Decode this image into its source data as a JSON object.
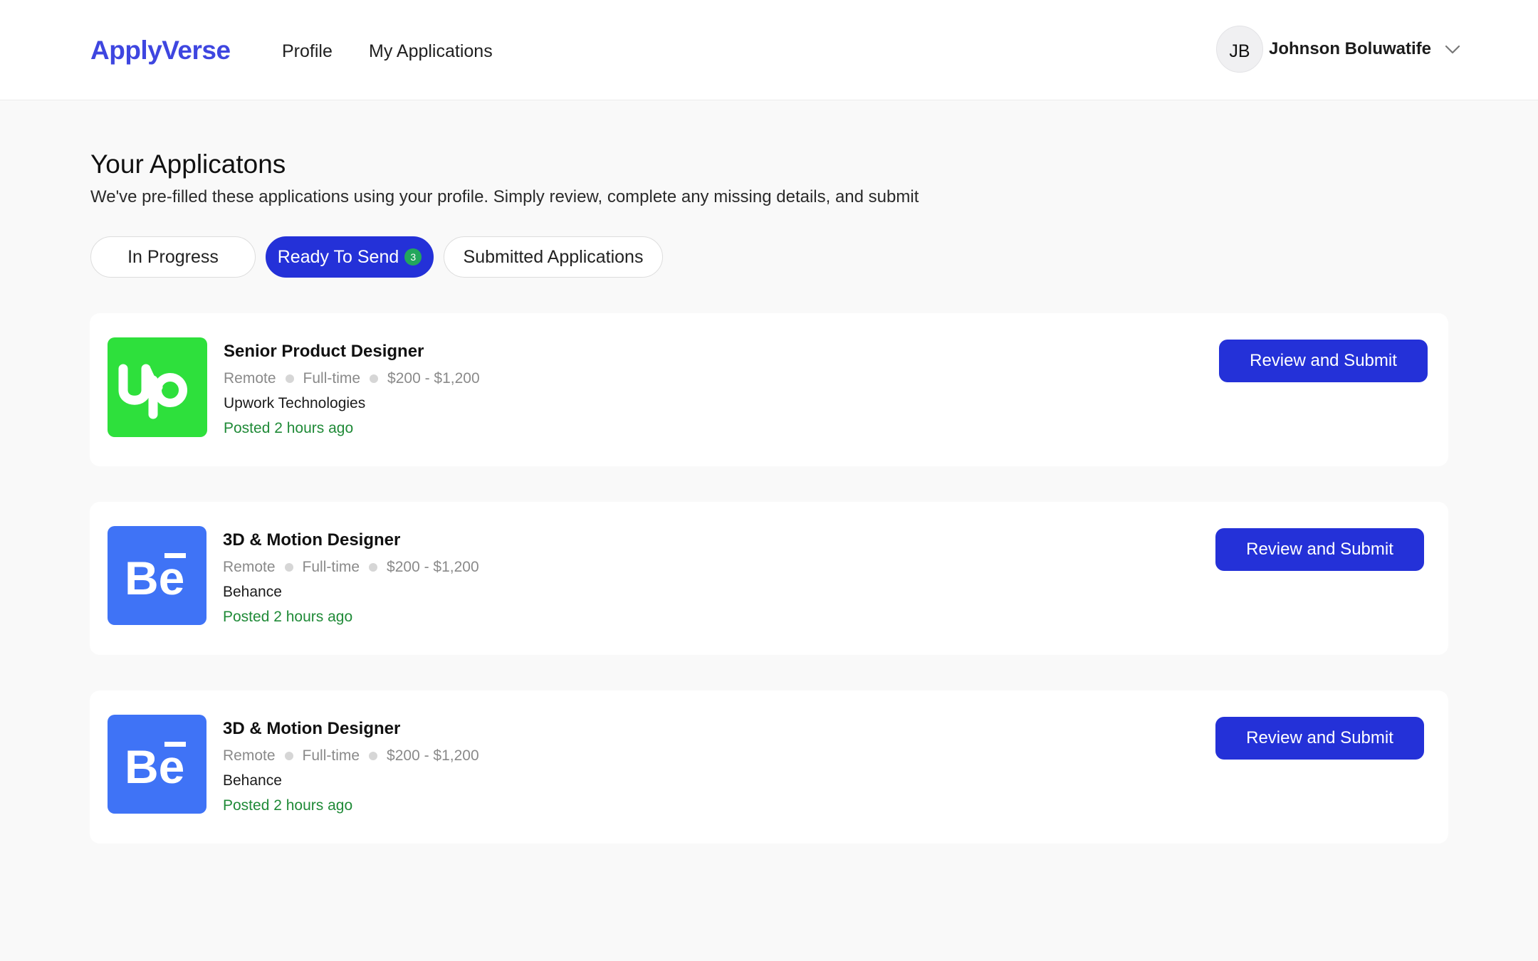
{
  "header": {
    "brand": "ApplyVerse",
    "nav": {
      "profile": "Profile",
      "my_applications": "My Applications"
    },
    "user": {
      "initials": "JB",
      "name": "Johnson Boluwatife"
    }
  },
  "page": {
    "title": "Your Applicatons",
    "subtitle": "We've pre-filled these applications using your profile. Simply review, complete any missing details, and submit"
  },
  "tabs": [
    {
      "label": "In Progress",
      "active": false
    },
    {
      "label": "Ready To Send",
      "active": true,
      "badge": "3"
    },
    {
      "label": "Submitted Applications",
      "active": false
    }
  ],
  "jobs": [
    {
      "title": "Senior Product Designer",
      "location": "Remote",
      "type": "Full-time",
      "salary": "$200 - $1,200",
      "company": "Upwork Technologies",
      "posted": "Posted 2 hours ago",
      "logo_icon": "upwork-logo-icon",
      "cta": "Review and Submit"
    },
    {
      "title": "3D & Motion Designer",
      "location": "Remote",
      "type": "Full-time",
      "salary": "$200 - $1,200",
      "company": "Behance",
      "posted": "Posted 2 hours ago",
      "logo_icon": "behance-logo-icon",
      "cta": "Review and Submit"
    },
    {
      "title": "3D & Motion Designer",
      "location": "Remote",
      "type": "Full-time",
      "salary": "$200 - $1,200",
      "company": "Behance",
      "posted": "Posted 2 hours ago",
      "logo_icon": "behance-logo-icon",
      "cta": "Review and Submit"
    }
  ],
  "colors": {
    "brand": "#3e46e0",
    "primary_button": "#2431d8",
    "upwork_green": "#2ee03c",
    "behance_blue": "#3f73f6",
    "posted_green": "#1f8a37",
    "badge_green": "#22a65c"
  }
}
